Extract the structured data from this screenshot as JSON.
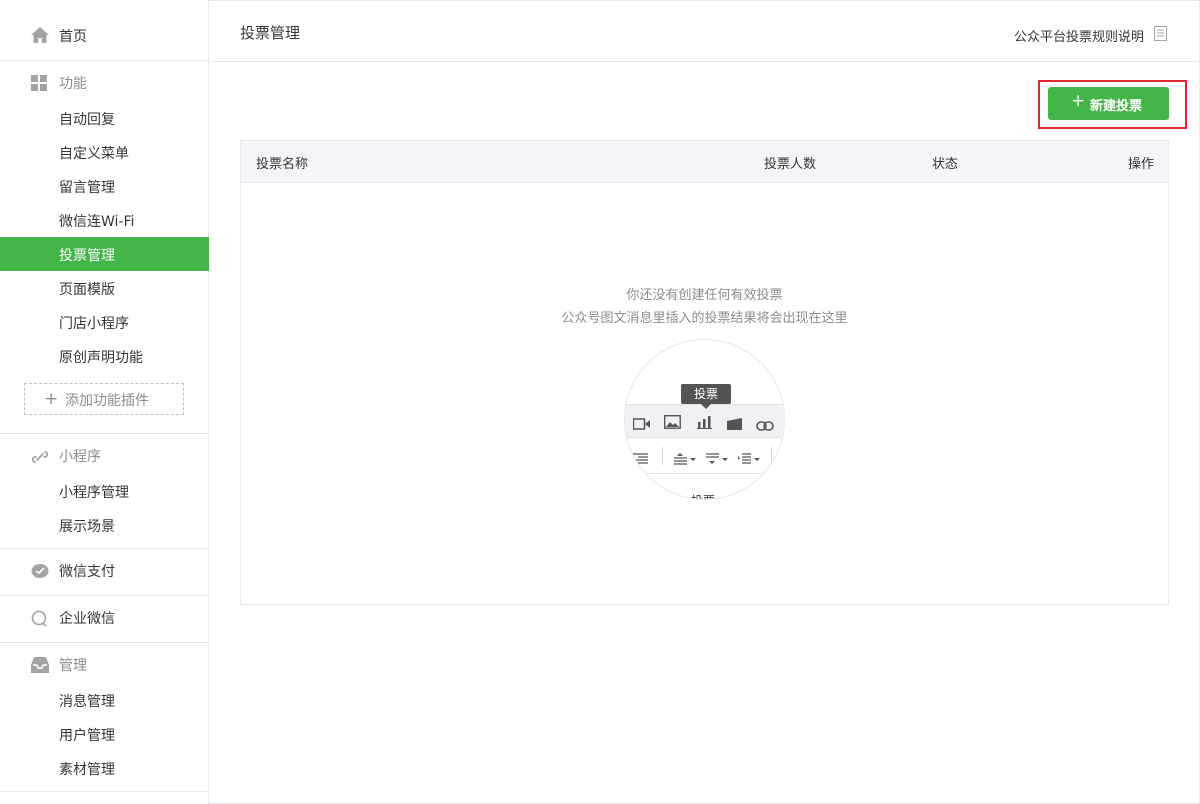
{
  "sidebar": {
    "home": {
      "label": "首页",
      "icon": "home-icon"
    },
    "groups": [
      {
        "title": "功能",
        "icon": "grid-icon",
        "items": [
          "自动回复",
          "自定义菜单",
          "留言管理",
          "微信连Wi-Fi",
          "投票管理",
          "页面模版",
          "门店小程序",
          "原创声明功能"
        ],
        "active": "投票管理"
      },
      {
        "title": "小程序",
        "icon": "link-icon",
        "items": [
          "小程序管理",
          "展示场景"
        ]
      },
      {
        "title": "微信支付",
        "icon": "pay-icon",
        "items": []
      },
      {
        "title": "企业微信",
        "icon": "chat-icon",
        "items": []
      },
      {
        "title": "管理",
        "icon": "inbox-icon",
        "items": [
          "消息管理",
          "用户管理",
          "素材管理"
        ]
      }
    ],
    "add_plugin": "添加功能插件"
  },
  "header": {
    "title": "投票管理",
    "rules_link": "公众平台投票规则说明"
  },
  "toolbar": {
    "new_vote": "新建投票"
  },
  "table": {
    "columns": [
      "投票名称",
      "投票人数",
      "状态",
      "操作"
    ],
    "empty_line1": "你还没有创建任何有效投票",
    "empty_line2": "公众号图文消息里插入的投票结果将会出现在这里"
  },
  "illustration": {
    "tooltip": "投票",
    "cut_text": "投票"
  },
  "colors": {
    "accent": "#44b549",
    "highlight": "#e0282f",
    "muted": "#8d8d8d"
  }
}
